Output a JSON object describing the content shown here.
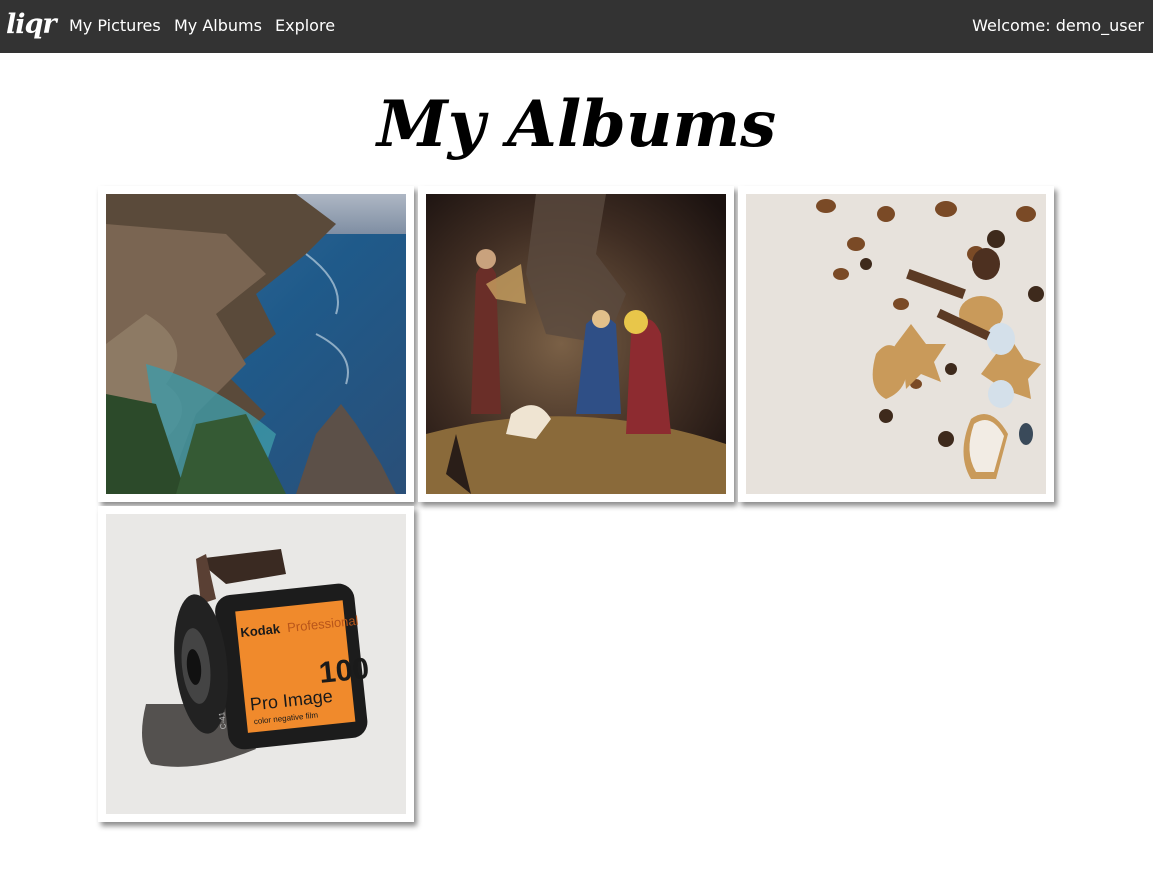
{
  "nav": {
    "brand": "liqr",
    "links": [
      "My Pictures",
      "My Albums",
      "Explore"
    ],
    "welcome": "Welcome: demo_user"
  },
  "main": {
    "title": "My Albums"
  },
  "albums": [
    {
      "subject": "coastline-cliffs-ocean"
    },
    {
      "subject": "nativity-scene-figurines"
    },
    {
      "subject": "gingerbread-cookies-spices"
    },
    {
      "subject": "kodak-film-canister",
      "label_brand": "Kodak",
      "label_line": "Professional",
      "label_name": "Pro Image",
      "label_speed": "100",
      "label_sub": "color negative film",
      "label_code": "C-41"
    }
  ],
  "colors": {
    "navbar_bg": "#333333",
    "nav_text": "#ffffff",
    "page_bg": "#ffffff",
    "title": "#000000"
  }
}
